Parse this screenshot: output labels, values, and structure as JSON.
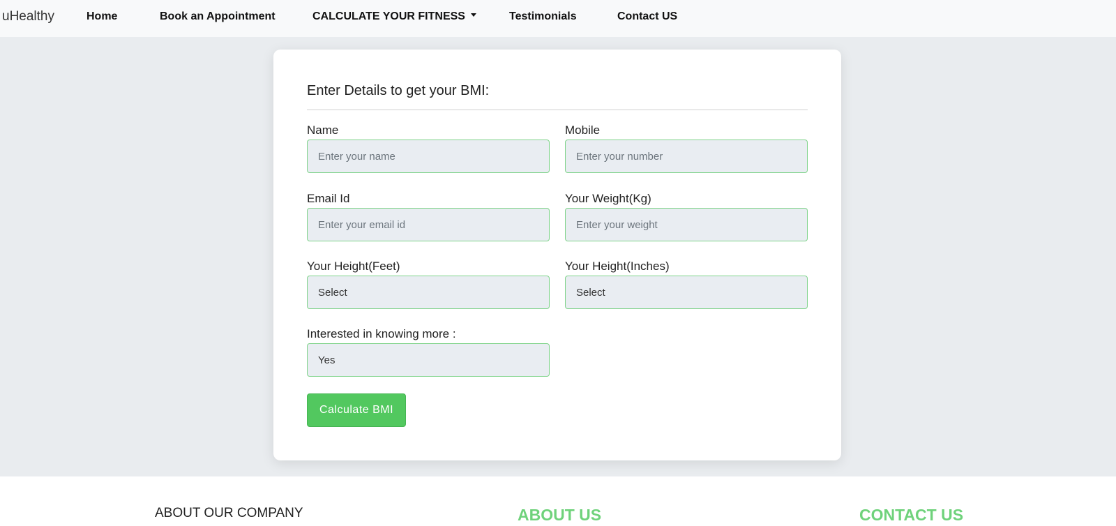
{
  "navbar": {
    "brand": "uHealthy",
    "items": [
      {
        "label": "Home"
      },
      {
        "label": "Book an Appointment"
      },
      {
        "label": "CALCULATE YOUR FITNESS"
      },
      {
        "label": "Testimonials"
      },
      {
        "label": "Contact US"
      }
    ]
  },
  "form": {
    "title": "Enter Details to get your BMI:",
    "name": {
      "label": "Name",
      "placeholder": "Enter your name"
    },
    "mobile": {
      "label": "Mobile",
      "placeholder": "Enter your number"
    },
    "email": {
      "label": "Email Id",
      "placeholder": "Enter your email id"
    },
    "weight": {
      "label": "Your Weight(Kg)",
      "placeholder": "Enter your weight"
    },
    "height_feet": {
      "label": "Your Height(Feet)",
      "value": "Select"
    },
    "height_inches": {
      "label": "Your Height(Inches)",
      "value": "Select"
    },
    "interested": {
      "label": "Interested in knowing more :",
      "value": "Yes"
    },
    "submit_label": "Calculate BMI"
  },
  "footer": {
    "about_company": "ABOUT OUR COMPANY",
    "about_us": "ABOUT US",
    "contact_us": "CONTACT US"
  },
  "colors": {
    "accent_green": "#52c85f",
    "footer_heading_green": "#6fd27b",
    "field_border": "#7fd38a"
  }
}
